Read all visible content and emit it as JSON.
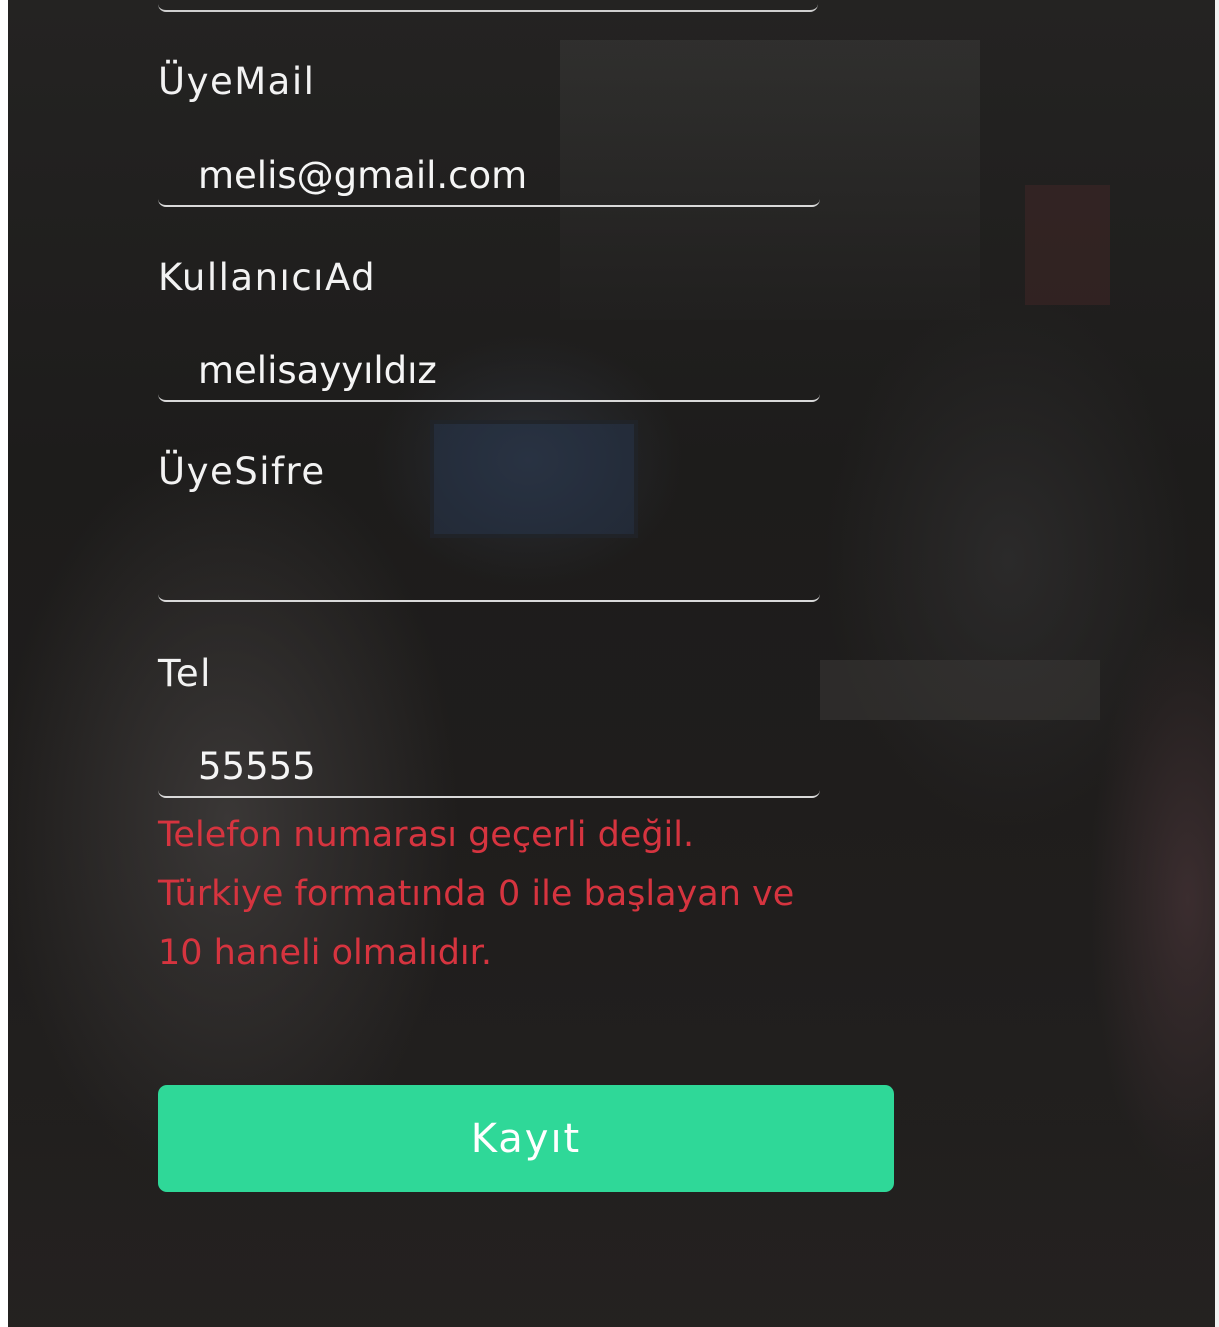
{
  "form": {
    "fields": [
      {
        "label": "ÜyeMail",
        "value": "melis@gmail.com",
        "type": "email"
      },
      {
        "label": "KullanıcıAd",
        "value": "melisayyıldız",
        "type": "text"
      },
      {
        "label": "ÜyeSifre",
        "value": "",
        "type": "password"
      },
      {
        "label": "Tel",
        "value": "55555",
        "type": "tel"
      }
    ],
    "error": {
      "line1": "Telefon numarası geçerli değil.",
      "line2": "Türkiye formatında 0 ile başlayan ve",
      "line3": "10 haneli olmalıdır."
    },
    "submit_label": "Kayıt"
  },
  "colors": {
    "accent": "#2fd898",
    "error": "#d6343f",
    "text": "#f2f2f2"
  }
}
